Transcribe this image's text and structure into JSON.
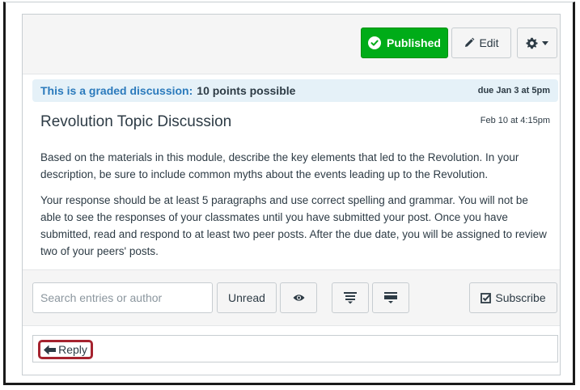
{
  "header": {
    "published_label": "Published",
    "edit_label": "Edit"
  },
  "graded": {
    "label": "This is a graded discussion:",
    "points": "10 points possible",
    "due": "due Jan 3 at 5pm"
  },
  "topic": {
    "title": "Revolution Topic Discussion",
    "date": "Feb 10 at 4:15pm",
    "paragraphs": [
      "Based on the materials in this module, describe the key elements that led to the Revolution. In your description, be sure to include common myths about the events leading up to the Revolution.",
      "Your response should be at least 5 paragraphs and use correct spelling and grammar. You will not be able to see the responses of your classmates until you have submitted your post. Once you have submitted, read and respond to at least two peer posts. After the due date, you will be assigned to review two of your peers' posts."
    ]
  },
  "toolbar": {
    "search_placeholder": "Search entries or author",
    "search_value": "",
    "unread_label": "Unread",
    "subscribe_label": "Subscribe"
  },
  "reply": {
    "label": "Reply"
  },
  "colors": {
    "published_green": "#00ac18",
    "graded_blue": "#2b7abc",
    "graded_bg": "#e5f1f8",
    "reply_highlight": "#a5232f"
  },
  "icons": {
    "published": "check-circle-icon",
    "edit": "pencil-icon",
    "settings": "gear-icon",
    "dropdown": "caret-down-icon",
    "eye": "eye-icon",
    "expand": "expand-all-icon",
    "collapse": "collapse-all-icon",
    "subscribe": "checkbox-icon",
    "reply": "reply-arrow-icon"
  }
}
